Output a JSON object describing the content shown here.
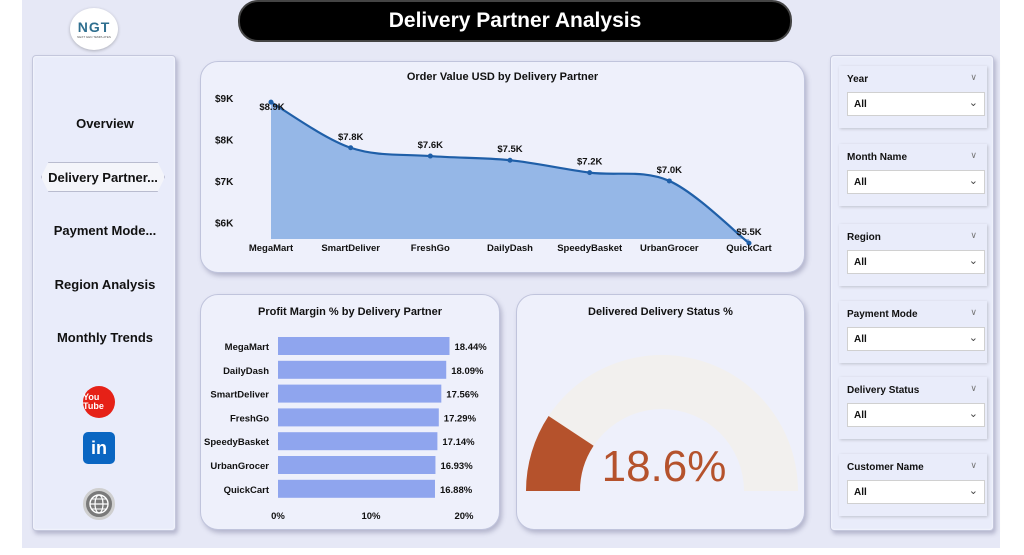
{
  "header": {
    "title": "Delivery Partner Analysis",
    "logo_text": "NGT",
    "logo_subtext": "NEXT GEN TEMPLATES"
  },
  "nav": {
    "items": [
      {
        "label": "Overview"
      },
      {
        "label": "Delivery Partner..."
      },
      {
        "label": "Payment Mode..."
      },
      {
        "label": "Region Analysis"
      },
      {
        "label": "Monthly Trends"
      }
    ],
    "active_index": 1,
    "social": [
      {
        "icon": "youtube-icon",
        "text": "You Tube"
      },
      {
        "icon": "linkedin-icon",
        "text": "in"
      },
      {
        "icon": "globe-icon",
        "text": "www"
      }
    ]
  },
  "filters": [
    {
      "label": "Year",
      "value": "All"
    },
    {
      "label": "Month Name",
      "value": "All"
    },
    {
      "label": "Region",
      "value": "All"
    },
    {
      "label": "Payment Mode",
      "value": "All"
    },
    {
      "label": "Delivery Status",
      "value": "All"
    },
    {
      "label": "Customer Name",
      "value": "All"
    }
  ],
  "colors": {
    "area_fill": "#8fb3e6",
    "area_line": "#1f5fa8",
    "bar_fill": "#8fa5ee",
    "gauge_fill": "#b5522c",
    "gauge_track": "#f2f0ee",
    "title_bar": "#000000"
  },
  "chart_data": [
    {
      "type": "area",
      "title": "Order Value USD by Delivery Partner",
      "categories": [
        "MegaMart",
        "SmartDeliver",
        "FreshGo",
        "DailyDash",
        "SpeedyBasket",
        "UrbanGrocer",
        "QuickCart"
      ],
      "values": [
        8900,
        7800,
        7600,
        7500,
        7200,
        7000,
        5500
      ],
      "data_labels": [
        "$8.9K",
        "$7.8K",
        "$7.6K",
        "$7.5K",
        "$7.2K",
        "$7.0K",
        "$5.5K"
      ],
      "y_ticks": [
        "$9K",
        "$8K",
        "$7K",
        "$6K"
      ],
      "y_tick_values": [
        9000,
        8000,
        7000,
        6000
      ],
      "ylim": [
        5600,
        9000
      ]
    },
    {
      "type": "bar",
      "orientation": "horizontal",
      "title": "Profit Margin % by Delivery Partner",
      "categories": [
        "MegaMart",
        "DailyDash",
        "SmartDeliver",
        "FreshGo",
        "SpeedyBasket",
        "UrbanGrocer",
        "QuickCart"
      ],
      "values": [
        18.44,
        18.09,
        17.56,
        17.29,
        17.14,
        16.93,
        16.88
      ],
      "data_labels": [
        "18.44%",
        "18.09%",
        "17.56%",
        "17.29%",
        "17.14%",
        "16.93%",
        "16.88%"
      ],
      "x_ticks": [
        "0%",
        "10%",
        "20%"
      ],
      "xlim": [
        0,
        20
      ]
    },
    {
      "type": "gauge",
      "title": "Delivered Delivery Status %",
      "value": 18.6,
      "value_label": "18.6%",
      "range": [
        0,
        100
      ]
    }
  ]
}
